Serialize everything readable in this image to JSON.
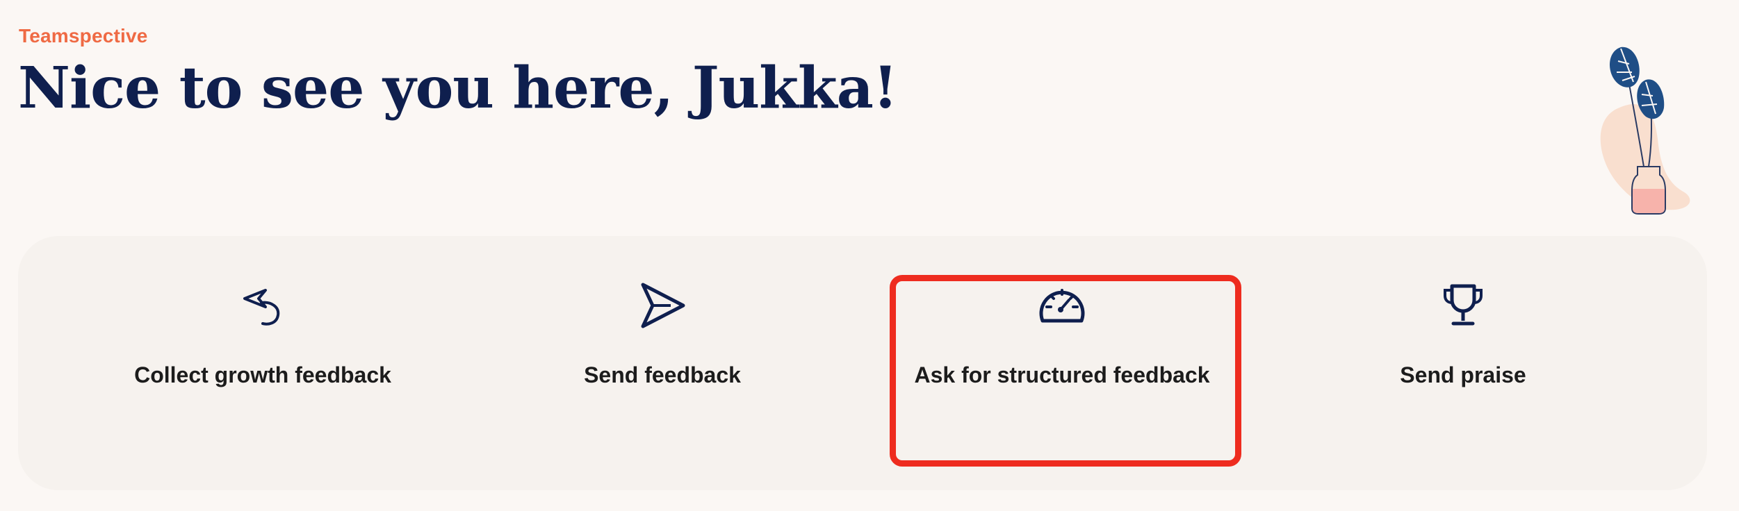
{
  "header": {
    "brand": "Teamspective",
    "greeting": "Nice to see you here, Jukka!"
  },
  "actions": [
    {
      "label": "Collect growth feedback",
      "icon": "reply-arrow-icon"
    },
    {
      "label": "Send feedback",
      "icon": "send-plane-icon"
    },
    {
      "label": "Ask for structured feedback",
      "icon": "gauge-icon",
      "highlighted": true
    },
    {
      "label": "Send praise",
      "icon": "trophy-icon"
    }
  ],
  "colors": {
    "background": "#fbf7f4",
    "panel": "#f6f2ee",
    "brand": "#ef6a44",
    "heading": "#0f1f4e",
    "icon": "#0f1f4e",
    "highlight": "#ee2c1f"
  }
}
